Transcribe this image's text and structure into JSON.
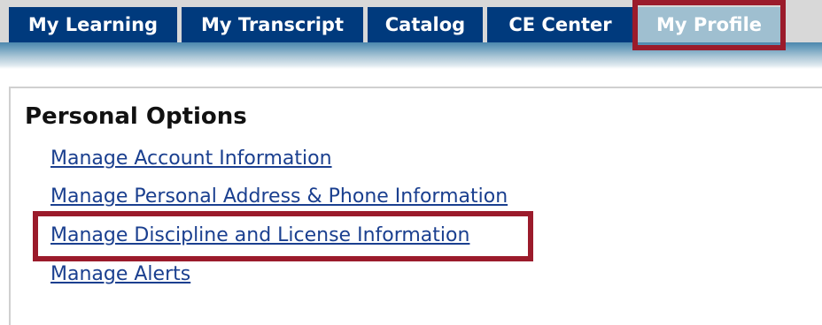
{
  "nav": {
    "tabs": [
      {
        "label": "My Learning"
      },
      {
        "label": "My Transcript"
      },
      {
        "label": "Catalog"
      },
      {
        "label": "CE Center"
      },
      {
        "label": "My Profile",
        "active": true
      }
    ]
  },
  "personal_options": {
    "title": "Personal Options",
    "links": [
      {
        "label": "Manage Account Information"
      },
      {
        "label": "Manage Personal Address & Phone Information"
      },
      {
        "label": "Manage Discipline and License Information",
        "highlighted": true
      },
      {
        "label": "Manage Alerts"
      }
    ]
  },
  "colors": {
    "tab_bg": "#003a7d",
    "active_tab_bg": "#9fbfd0",
    "link": "#1a3f8f",
    "highlight_border": "#9b1b2b"
  }
}
